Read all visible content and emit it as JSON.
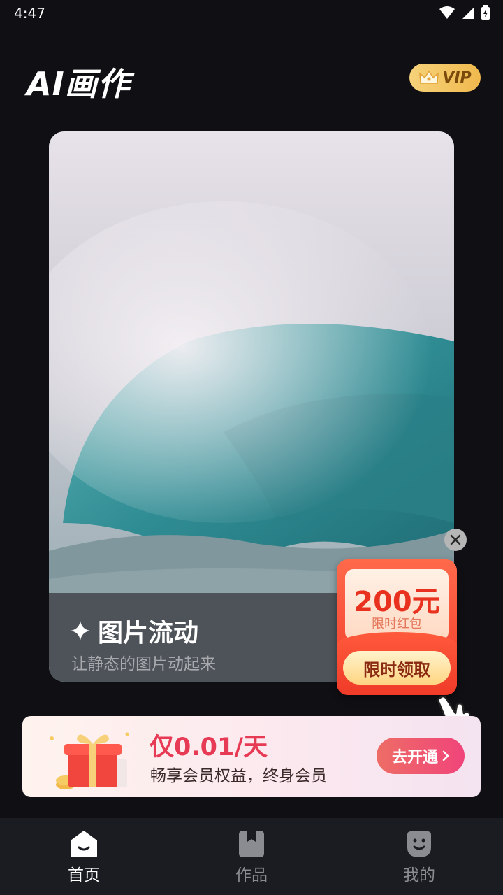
{
  "status_bar": {
    "time": "4:47"
  },
  "header": {
    "logo": "AI画作",
    "vip_label": "VIP"
  },
  "feature_card": {
    "title": "图片流动",
    "subtitle": "让静态的图片动起来"
  },
  "red_packet": {
    "amount": "200元",
    "note": "限时红包",
    "button": "限时领取"
  },
  "vip_banner": {
    "price": "仅0.01/天",
    "description": "畅享会员权益，终身会员",
    "button": "去开通"
  },
  "bottom_nav": [
    {
      "label": "首页",
      "icon": "home-icon",
      "active": true
    },
    {
      "label": "作品",
      "icon": "works-icon",
      "active": false
    },
    {
      "label": "我的",
      "icon": "profile-icon",
      "active": false
    }
  ],
  "colors": {
    "background": "#0f0f14",
    "vip_gold": "#f0b94e",
    "accent_red": "#e63a55",
    "nav_bg": "#1a1c22"
  }
}
